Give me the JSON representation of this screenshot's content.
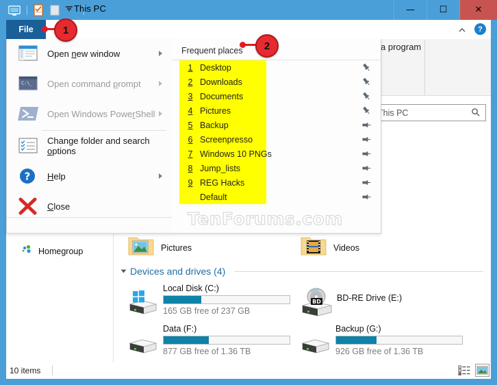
{
  "window": {
    "title": "This PC",
    "quick_access_icons": [
      "this-pc-icon",
      "properties-icon",
      "new-folder-icon",
      "customize-chevron-icon"
    ],
    "minimize_glyph": "—",
    "maximize_glyph": "☐",
    "close_glyph": "✕"
  },
  "ribbon": {
    "file_tab": "File",
    "collapse_tooltip": "^",
    "help_glyph": "?",
    "ghost_text": "a program"
  },
  "search": {
    "value": "This PC",
    "placeholder": "Search This PC",
    "icon": "search-icon"
  },
  "file_menu": {
    "items": [
      {
        "label_pre": "Open ",
        "accel": "n",
        "label_post": "ew window",
        "icon": "new-window-icon",
        "disabled": false,
        "has_submenu": true
      },
      {
        "label_pre": "Open command ",
        "accel": "p",
        "label_post": "rompt",
        "icon": "command-prompt-icon",
        "disabled": true,
        "has_submenu": true
      },
      {
        "label_pre": "Open Windows Powe",
        "accel": "r",
        "label_post": "Shell",
        "icon": "powershell-icon",
        "disabled": true,
        "has_submenu": true
      },
      {
        "label_pre": "Change folder and search ",
        "accel": "o",
        "label_post": "ptions",
        "icon": "folder-options-icon",
        "disabled": false,
        "has_submenu": false
      },
      {
        "label_pre": "",
        "accel": "H",
        "label_post": "elp",
        "icon": "help-icon",
        "disabled": false,
        "has_submenu": true
      },
      {
        "label_pre": "",
        "accel": "C",
        "label_post": "lose",
        "icon": "close-x-icon",
        "disabled": false,
        "has_submenu": false
      }
    ]
  },
  "frequent_places": {
    "title": "Frequent places",
    "items": [
      {
        "num": "1",
        "name": "Desktop",
        "pin": "unpinned"
      },
      {
        "num": "2",
        "name": "Downloads",
        "pin": "unpinned"
      },
      {
        "num": "3",
        "name": "Documents",
        "pin": "unpinned"
      },
      {
        "num": "4",
        "name": "Pictures",
        "pin": "unpinned"
      },
      {
        "num": "5",
        "name": "Backup",
        "pin": "pinned"
      },
      {
        "num": "6",
        "name": "Screenpresso",
        "pin": "pinned"
      },
      {
        "num": "7",
        "name": "Windows 10 PNGs",
        "pin": "pinned"
      },
      {
        "num": "8",
        "name": "Jump_lists",
        "pin": "pinned"
      },
      {
        "num": "9",
        "name": "REG Hacks",
        "pin": "pinned"
      },
      {
        "num": "",
        "name": "Default",
        "pin": "pinned"
      }
    ]
  },
  "nav_pane": {
    "homegroup_label": "Homegroup",
    "homegroup_icon": "homegroup-icon"
  },
  "content": {
    "folders": [
      {
        "name": "Pictures",
        "icon": "pictures-folder-icon"
      },
      {
        "name": "Videos",
        "icon": "videos-folder-icon"
      }
    ],
    "devices_group_title": "Devices and drives (4)",
    "drives": [
      {
        "name": "Local Disk (C:)",
        "free": "165 GB free of 237 GB",
        "used_pct": 30,
        "icon": "windows-drive-icon",
        "has_bar": true
      },
      {
        "name": "BD-RE Drive (E:)",
        "free": "",
        "used_pct": 0,
        "icon": "bd-drive-icon",
        "has_bar": false
      },
      {
        "name": "Data (F:)",
        "free": "877 GB free of 1.36 TB",
        "used_pct": 36,
        "icon": "hard-drive-icon",
        "has_bar": true
      },
      {
        "name": "Backup (G:)",
        "free": "926 GB free of 1.36 TB",
        "used_pct": 32,
        "icon": "hard-drive-icon",
        "has_bar": true
      }
    ]
  },
  "status_bar": {
    "item_count": "10 items",
    "view_details_icon": "details-view-icon",
    "view_large_icons_icon": "large-icons-view-icon"
  },
  "watermark": {
    "text": "TenForums.com"
  },
  "annotations": [
    {
      "number": "1",
      "target": "file-tab"
    },
    {
      "number": "2",
      "target": "frequent-places-title"
    }
  ],
  "colors": {
    "titlebar": "#4a9fd8",
    "file_tab": "#1b5f99",
    "close_button": "#c75450",
    "highlight": "#ffff00",
    "annotation": "#e52a30",
    "progress_fill": "#0d83a8",
    "group_title": "#1d6fa5"
  }
}
